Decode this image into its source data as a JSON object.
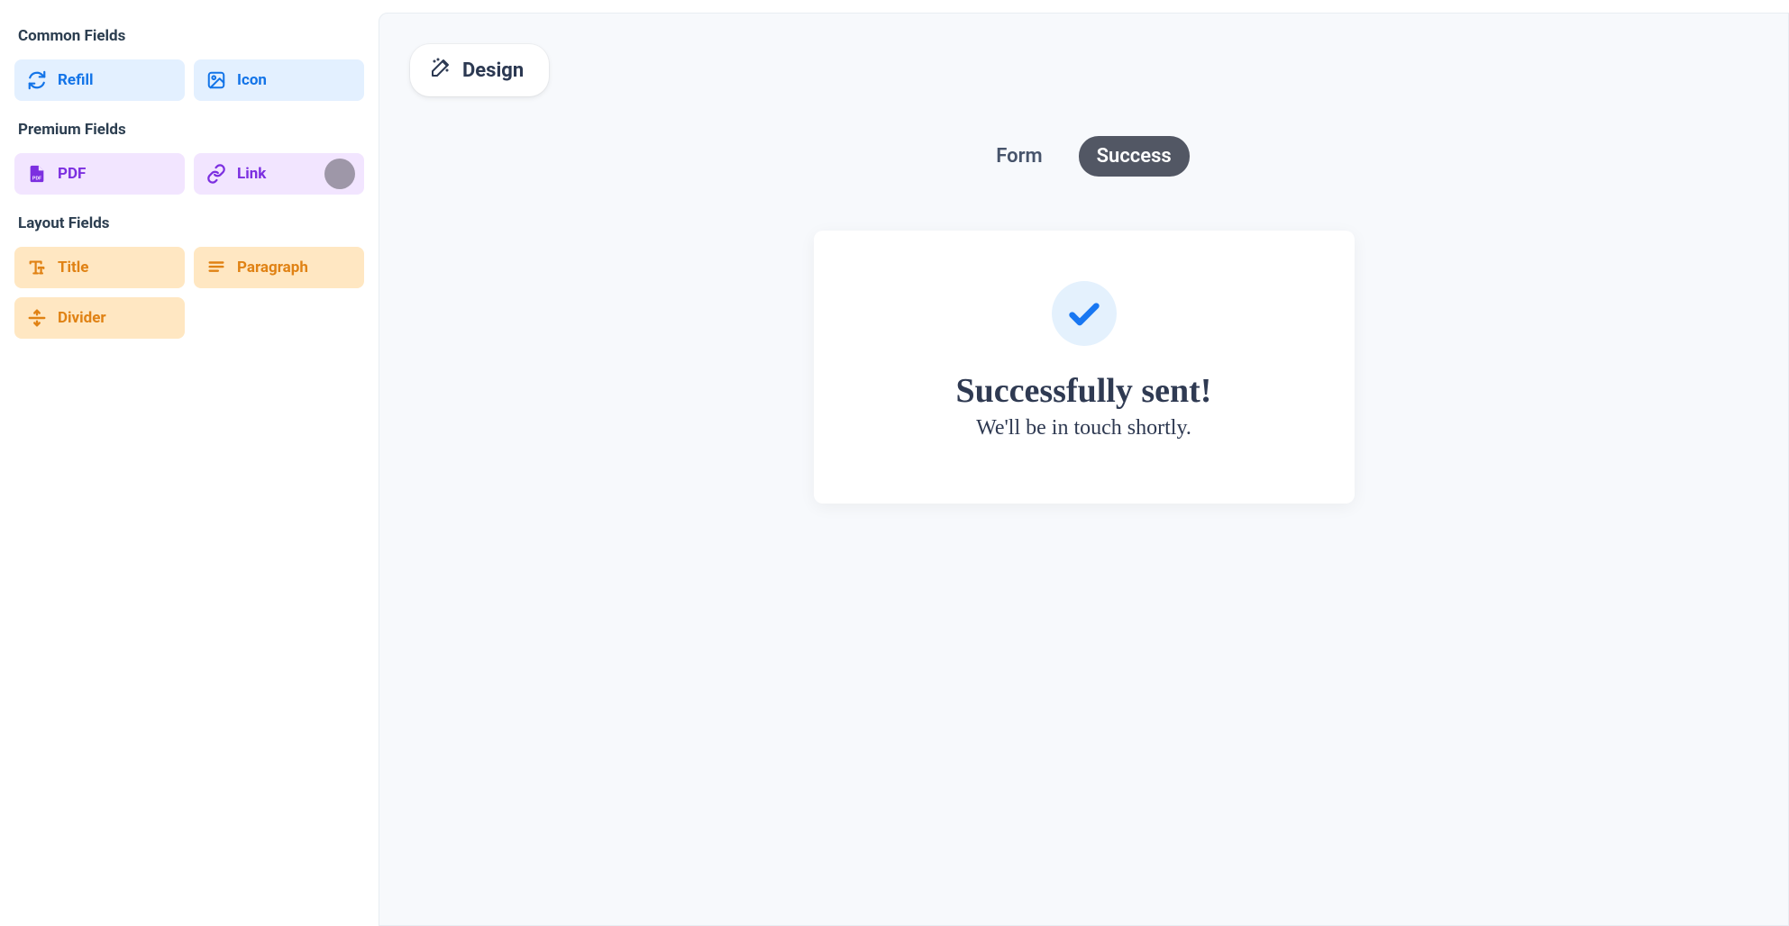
{
  "sidebar": {
    "sections": {
      "common": {
        "heading": "Common Fields",
        "items": [
          {
            "label": "Refill",
            "icon": "refresh-icon"
          },
          {
            "label": "Icon",
            "icon": "image-icon"
          }
        ]
      },
      "premium": {
        "heading": "Premium Fields",
        "items": [
          {
            "label": "PDF",
            "icon": "pdf-file-icon"
          },
          {
            "label": "Link",
            "icon": "link-icon"
          }
        ]
      },
      "layout": {
        "heading": "Layout Fields",
        "items": [
          {
            "label": "Title",
            "icon": "title-icon"
          },
          {
            "label": "Paragraph",
            "icon": "paragraph-icon"
          },
          {
            "label": "Divider",
            "icon": "divider-icon"
          }
        ]
      }
    }
  },
  "toolbar": {
    "design_label": "Design"
  },
  "tabs": {
    "form_label": "Form",
    "success_label": "Success",
    "active": "success"
  },
  "preview": {
    "title": "Successfully sent!",
    "subtitle": "We'll be in touch shortly."
  },
  "colors": {
    "common_bg": "#e3f0ff",
    "common_fg": "#1374e8",
    "premium_bg": "#f2e5ff",
    "premium_fg": "#7c2fe0",
    "layout_bg": "#ffe7c2",
    "layout_fg": "#e08214",
    "canvas_bg": "#f7f9fc",
    "accent_blue": "#1877f2"
  }
}
